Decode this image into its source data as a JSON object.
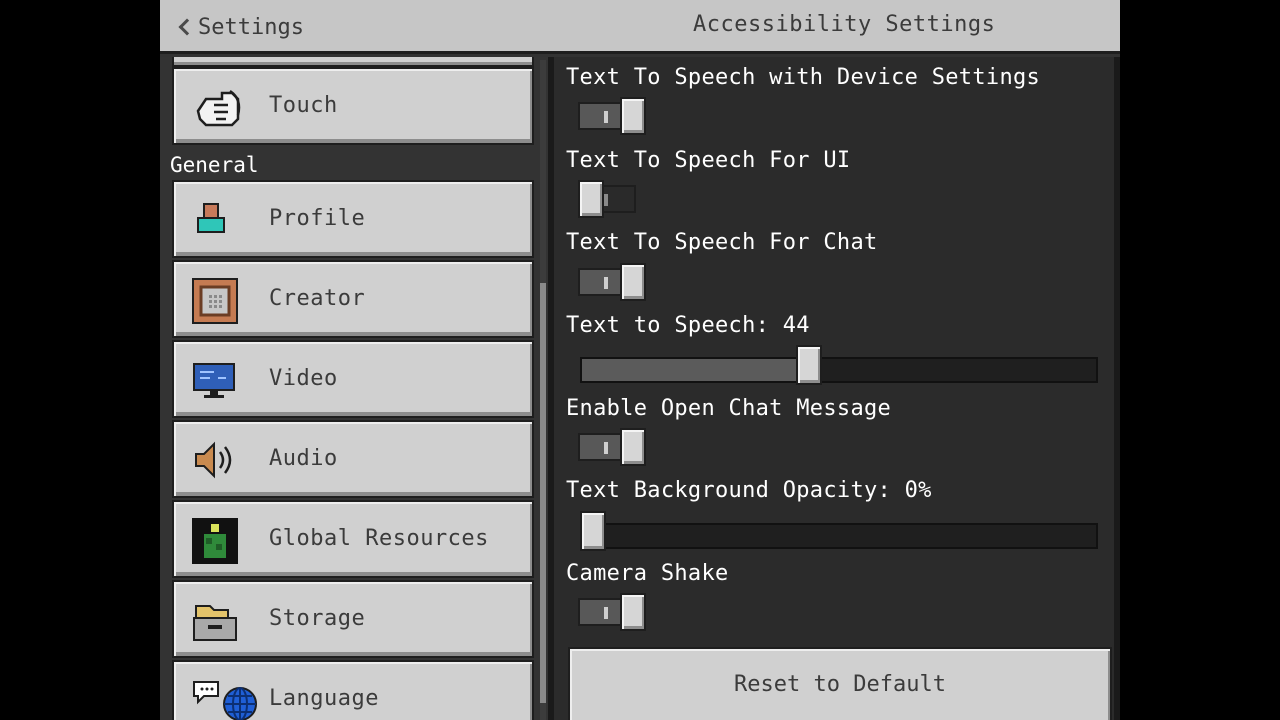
{
  "header": {
    "back_label": "Settings",
    "title": "Accessibility Settings"
  },
  "sidebar": {
    "touch_label": "Touch",
    "section_general": "General",
    "items": [
      {
        "label": "Profile",
        "icon": "profile-icon"
      },
      {
        "label": "Creator",
        "icon": "command-block-icon"
      },
      {
        "label": "Video",
        "icon": "monitor-icon"
      },
      {
        "label": "Audio",
        "icon": "speaker-icon"
      },
      {
        "label": "Global Resources",
        "icon": "resource-pack-icon"
      },
      {
        "label": "Storage",
        "icon": "storage-icon"
      },
      {
        "label": "Language",
        "icon": "language-icon"
      }
    ]
  },
  "options": {
    "tts_device": {
      "label": "Text To Speech with Device Settings",
      "state": "on"
    },
    "tts_ui": {
      "label": "Text To Speech For UI",
      "state": "off"
    },
    "tts_chat": {
      "label": "Text To Speech For Chat",
      "state": "on"
    },
    "tts_volume": {
      "label": "Text to Speech: 44",
      "value": 44,
      "max": 100
    },
    "open_chat": {
      "label": "Enable Open Chat Message",
      "state": "on"
    },
    "text_bg_opacity": {
      "label": "Text Background Opacity: 0%",
      "value": 0,
      "max": 100
    },
    "camera_shake": {
      "label": "Camera Shake",
      "state": "on"
    }
  },
  "reset_label": "Reset to Default",
  "colors": {
    "header_bg": "#c6c6c6",
    "button_bg": "#d0d0d0",
    "panel_bg": "#2b2b2b",
    "toggle_on_track": "#585858"
  }
}
